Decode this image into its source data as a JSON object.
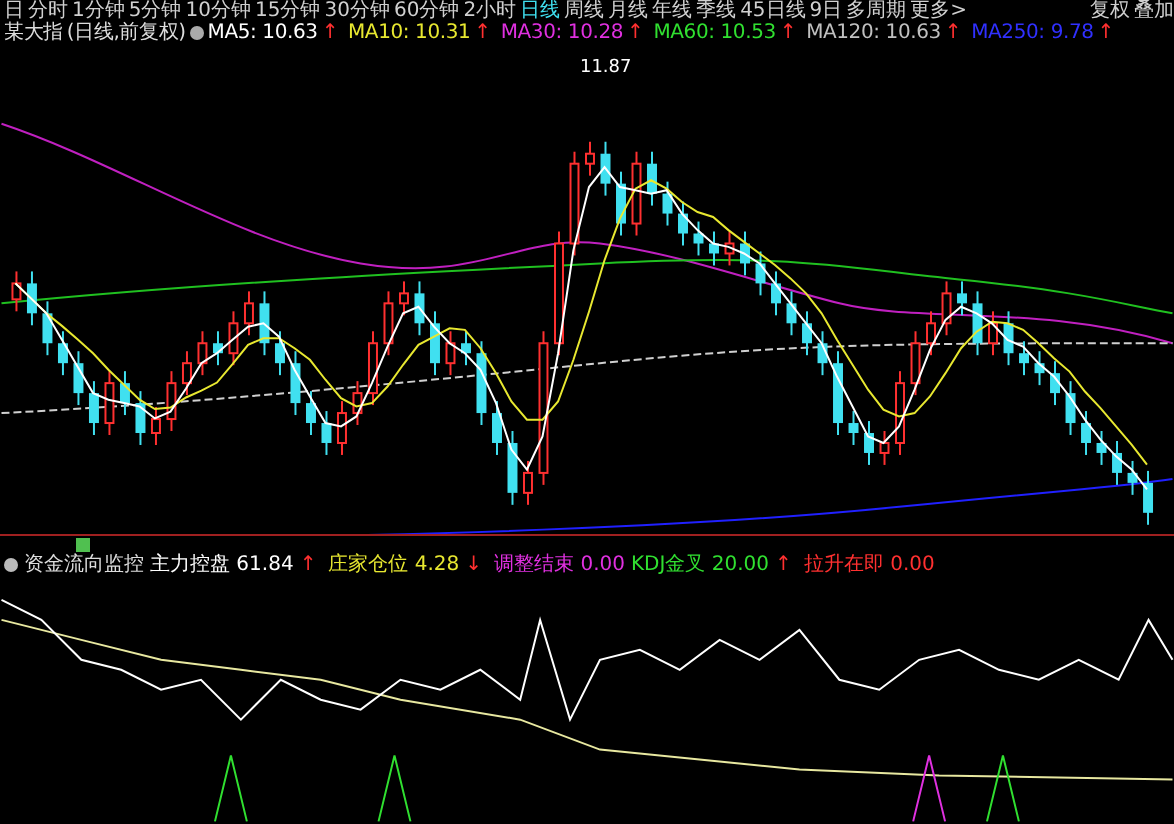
{
  "top_bar": {
    "periods": [
      {
        "label": "日",
        "selected": false
      },
      {
        "label": "分时",
        "selected": false
      },
      {
        "label": "1分钟",
        "selected": false
      },
      {
        "label": "5分钟",
        "selected": false
      },
      {
        "label": "10分钟",
        "selected": false
      },
      {
        "label": "15分钟",
        "selected": false
      },
      {
        "label": "30分钟",
        "selected": false
      },
      {
        "label": "60分钟",
        "selected": false
      },
      {
        "label": "2小时",
        "selected": false
      },
      {
        "label": "日线",
        "selected": true
      },
      {
        "label": "周线",
        "selected": false
      },
      {
        "label": "月线",
        "selected": false
      },
      {
        "label": "年线",
        "selected": false
      },
      {
        "label": "季线",
        "selected": false
      },
      {
        "label": "45日线",
        "selected": false
      },
      {
        "label": "9日",
        "selected": false
      },
      {
        "label": "多周期",
        "selected": false
      },
      {
        "label": "更多>",
        "selected": false
      }
    ],
    "buttons": [
      "复权",
      "叠加"
    ]
  },
  "legend": {
    "title": "某大指",
    "params": "(日线,前复权)",
    "averages": [
      {
        "name": "MA5:",
        "value": "10.63",
        "arrow": "↑",
        "color": "#ffffff"
      },
      {
        "name": "MA10:",
        "value": "10.31",
        "arrow": "↑",
        "color": "#e8e830"
      },
      {
        "name": "MA30:",
        "value": "10.28",
        "arrow": "↑",
        "color": "#e030e0"
      },
      {
        "name": "MA60:",
        "value": "10.53",
        "arrow": "↑",
        "color": "#30e030"
      },
      {
        "name": "MA120:",
        "value": "10.63",
        "arrow": "↑",
        "color": "#c0c0c0"
      },
      {
        "name": "MA250:",
        "value": "9.78",
        "arrow": "↑",
        "color": "#3030ff"
      }
    ]
  },
  "main_chart": {
    "high_label": "11.87"
  },
  "indicator": {
    "title": "资金流向监控",
    "items": [
      {
        "name": "主力控盘",
        "value": "61.84",
        "arrow": "↑",
        "color": "#ffffff"
      },
      {
        "name": "庄家仓位",
        "value": "4.28",
        "arrow": "↓",
        "color": "#e8e830"
      },
      {
        "name": "调整结束",
        "value": "0.00",
        "color": "#e030e0"
      },
      {
        "name": "KDJ金叉",
        "value": "20.00",
        "arrow": "↑",
        "color": "#30e030"
      },
      {
        "name": "拉升在即",
        "value": "0.00",
        "color": "#ff3030"
      }
    ]
  }
}
